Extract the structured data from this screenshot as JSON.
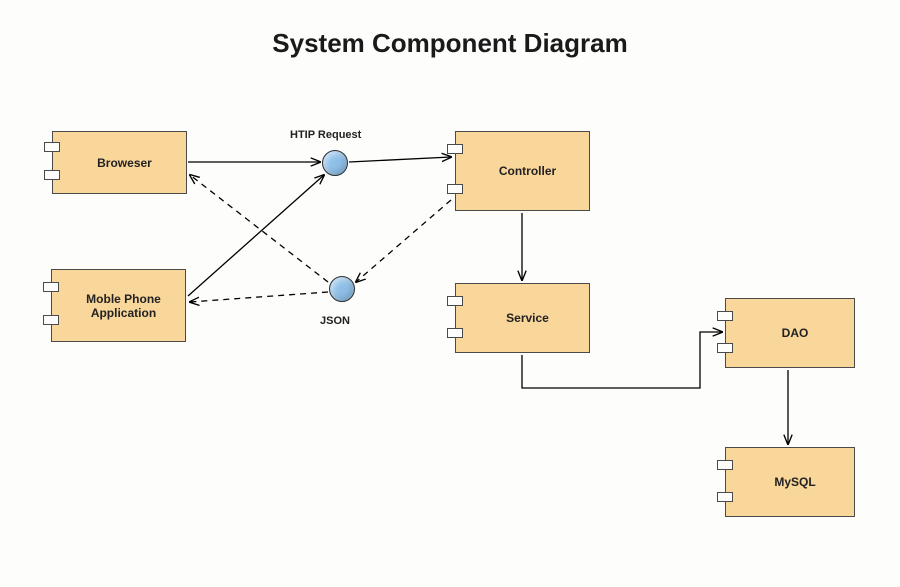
{
  "title": "System Component Diagram",
  "components": {
    "browser": {
      "label": "Broweser"
    },
    "mobile": {
      "label": "Moble Phone\nApplication"
    },
    "controller": {
      "label": "Controller"
    },
    "service": {
      "label": "Service"
    },
    "dao": {
      "label": "DAO"
    },
    "mysql": {
      "label": "MySQL"
    }
  },
  "connectors": {
    "httpRequest": {
      "label": "HTIP Request"
    },
    "json": {
      "label": "JSON"
    }
  }
}
